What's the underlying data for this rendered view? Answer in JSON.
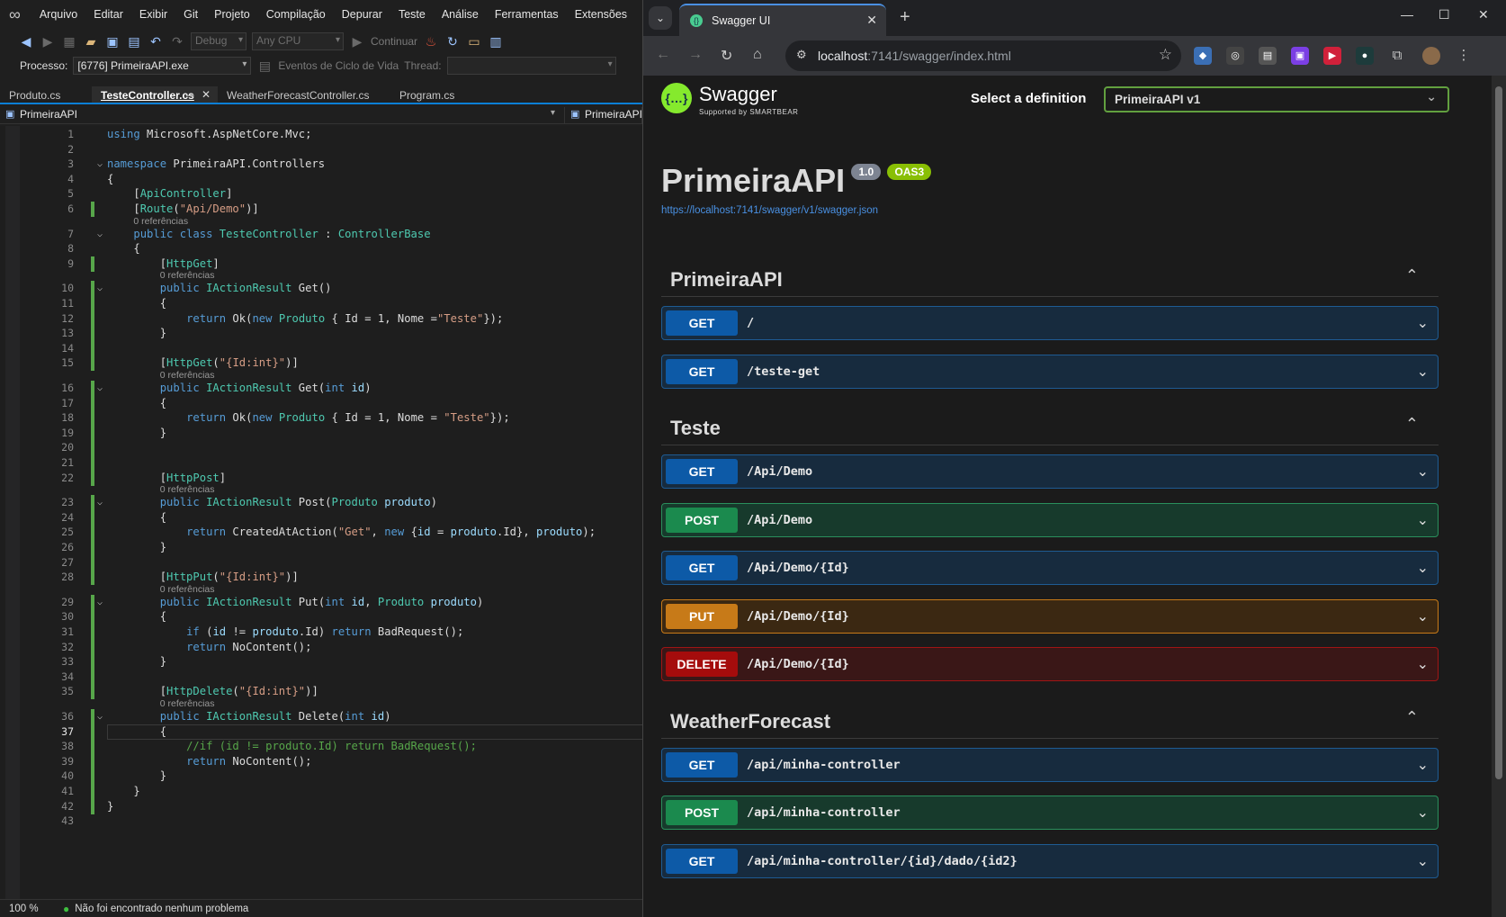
{
  "vs": {
    "menu": [
      "Arquivo",
      "Editar",
      "Exibir",
      "Git",
      "Projeto",
      "Compilação",
      "Depurar",
      "Teste",
      "Análise",
      "Ferramentas",
      "Extensões",
      "Ja"
    ],
    "toolbar": {
      "config": "Debug",
      "platform": "Any CPU",
      "continue": "Continuar"
    },
    "procbar": {
      "label": "Processo:",
      "process": "[6776] PrimeiraAPI.exe",
      "lifecycle": "Eventos de Ciclo de Vida",
      "thread": "Thread:"
    },
    "tabs": [
      {
        "label": "Produto.cs",
        "active": false
      },
      {
        "label": "TesteController.cs",
        "active": true
      },
      {
        "label": "WeatherForecastController.cs",
        "active": false
      },
      {
        "label": "Program.cs",
        "active": false
      }
    ],
    "nav": {
      "left": "PrimeiraAPI",
      "right": "PrimeiraAPI."
    },
    "refs_label": "0 referências",
    "status": {
      "zoom": "100 %",
      "message": "Não foi encontrado nenhum problema"
    }
  },
  "code_lines": [
    "using Microsoft.AspNetCore.Mvc;",
    "",
    "namespace PrimeiraAPI.Controllers",
    "{",
    "    [ApiController]",
    "    [Route(\"Api/Demo\")]",
    "    public class TesteController : ControllerBase",
    "    {",
    "        [HttpGet]",
    "        public IActionResult Get()",
    "        {",
    "            return Ok(new Produto { Id = 1, Nome =\"Teste\"});",
    "        }",
    "",
    "        [HttpGet(\"{Id:int}\")]",
    "        public IActionResult Get(int id)",
    "        {",
    "            return Ok(new Produto { Id = 1, Nome = \"Teste\"});",
    "        }",
    "",
    "",
    "        [HttpPost]",
    "        public IActionResult Post(Produto produto)",
    "        {",
    "            return CreatedAtAction(\"Get\", new {id = produto.Id}, produto);",
    "        }",
    "",
    "        [HttpPut(\"{Id:int}\")]",
    "        public IActionResult Put(int id, Produto produto)",
    "        {",
    "            if (id != produto.Id) return BadRequest();",
    "            return NoContent();",
    "        }",
    "",
    "        [HttpDelete(\"{Id:int}\")]",
    "        public IActionResult Delete(int id)",
    "        {",
    "            //if (id != produto.Id) return BadRequest();",
    "            return NoContent();",
    "        }",
    "    }",
    "}",
    ""
  ],
  "browser": {
    "tab_title": "Swagger UI",
    "url_host": "localhost",
    "url_rest": ":7141/swagger/index.html"
  },
  "swagger": {
    "logo_text": "Swagger",
    "logo_sub": "Supported by SMARTBEAR",
    "def_label": "Select a definition",
    "def_value": "PrimeiraAPI v1",
    "title": "PrimeiraAPI",
    "version": "1.0",
    "oas": "OAS3",
    "spec_url": "https://localhost:7141/swagger/v1/swagger.json",
    "tags": [
      {
        "name": "PrimeiraAPI",
        "ops": [
          {
            "method": "GET",
            "path": "/"
          },
          {
            "method": "GET",
            "path": "/teste-get"
          }
        ]
      },
      {
        "name": "Teste",
        "ops": [
          {
            "method": "GET",
            "path": "/Api/Demo"
          },
          {
            "method": "POST",
            "path": "/Api/Demo"
          },
          {
            "method": "GET",
            "path": "/Api/Demo/{Id}"
          },
          {
            "method": "PUT",
            "path": "/Api/Demo/{Id}"
          },
          {
            "method": "DELETE",
            "path": "/Api/Demo/{Id}"
          }
        ]
      },
      {
        "name": "WeatherForecast",
        "ops": [
          {
            "method": "GET",
            "path": "/api/minha-controller"
          },
          {
            "method": "POST",
            "path": "/api/minha-controller"
          },
          {
            "method": "GET",
            "path": "/api/minha-controller/{id}/dado/{id2}"
          }
        ]
      }
    ]
  }
}
